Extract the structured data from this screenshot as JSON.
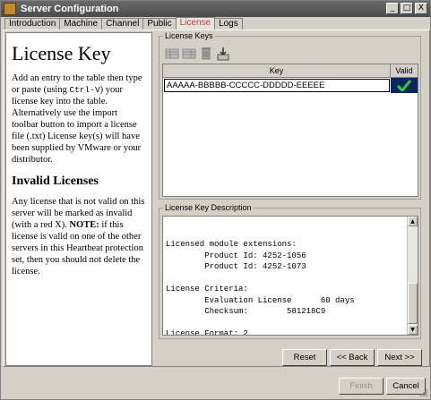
{
  "window": {
    "title": "Server Configuration"
  },
  "title_controls": {
    "minimize": "_",
    "maximize": "□",
    "close": "X"
  },
  "tabs": [
    {
      "label": "Introduction"
    },
    {
      "label": "Machine"
    },
    {
      "label": "Channel"
    },
    {
      "label": "Public"
    },
    {
      "label": "License"
    },
    {
      "label": "Logs"
    }
  ],
  "help": {
    "title": "License Key",
    "p1_a": "Add an entry to the table then type or paste (using ",
    "p1_code": "Ctrl-V",
    "p1_b": ") your license key into the table. Alternatively use the import toolbar button to import a license file (.txt) License key(s) will have been supplied by VMware or your distributor.",
    "h2": "Invalid Licenses",
    "p2_a": "Any license that is not valid on this server will be marked as invalid (with a red X). ",
    "p2_note": "NOTE:",
    "p2_b": " if this license is valid on one of the other servers in this Heartbeat protection set, then you should not delete the license."
  },
  "license_keys": {
    "group_label": "License Keys",
    "toolbar_icons": [
      "add-row-icon",
      "edit-row-icon",
      "delete-icon",
      "import-icon"
    ],
    "columns": {
      "key": "Key",
      "valid": "Valid"
    },
    "rows": [
      {
        "key": "AAAAA-BBBBB-CCCCC-DDDDD-EEEEE",
        "valid": "check-icon"
      }
    ]
  },
  "description": {
    "group_label": "License Key Description",
    "text": "\n\nLicensed module extensions:\n        Product Id: 4252-1056\n        Product Id: 4252-1073\n\nLicense Criteria:\n        Evaluation License      60 days\n        Checksum:        581218C9\n\nLicense Format: 2"
  },
  "buttons": {
    "reset": "Reset",
    "back": "<< Back",
    "next": "Next >>",
    "finish": "Finish",
    "cancel": "Cancel"
  },
  "colors": {
    "active_tab_text": "#c04040",
    "valid_cell_bg": "#0a2560",
    "check": "#33cc33"
  }
}
